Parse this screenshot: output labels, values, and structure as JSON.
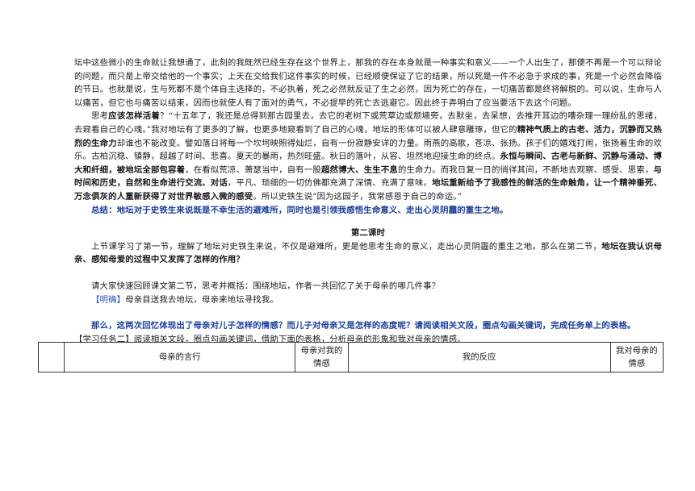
{
  "para1": "坛中这些微小的生命就让我想通了，此刻的我既然已经生存在这个世界上，那我的存在本身就是一种事实和意义——一个人出生了，那便不再是一个可以辩论的问题，而只是上帝交给他的一个事实；上天在交给我们这件事实的时候，已经顺便保证了它的结果，所以死是一件不必急于求成的事，死是一个必然会降临的节日。也就是说，生与死都不是个体自主选择的，不必执着，死之必然就反证了生之必然，因为死亡的存在，一切痛苦都是终将解脱的。可以说，生命与人以痛苦，但它也与痛苦以结束，因而也就使人有了面对的勇气，不必提早的死亡去逃避它。因此终于弄明白了应当要活下去这个问题。",
  "para2": {
    "s1": "思考",
    "s2": "应该怎样活着",
    "s3": "？“十五年了，我还是总得到那古园里去，去它的老树下或荒草边或颓墙旁，去默坐，去呆想，去推开耳边的嘈杂理一理纷乱的思绪，去窥看自己的心魂。”我对地坛有了更多的了解，也更多地窥看到了自己的心魂，地坛的形体可以被人肆意雕琢，但它的",
    "s4": "精神气质上的古老、活力，沉静而又热烈的生命力",
    "s5": "却谁也不能改变。譬如落日将每一个坎坷映照得灿烂，自有一份寂静安详的力量。雨燕的高歌，苍凉、张扬。孩子们的嬉戏打闹，张扬着生命的欢乐。古柏沉稳、镇静，超越了时间、悲喜。夏天的暴雨，热烈旺盛。秋日的落叶，从容、坦然地迎接生命的终点。",
    "s6": "永恒与瞬间、古老与新鲜、沉静与涌动、博大和纤细，被地坛全部包容着",
    "s7": "，在看似荒凉、萧瑟当中，自有一股",
    "s8": "超然博大、生生不息",
    "s9": "的生命力。而我日复一日的徜徉其间，不断地去观察、感受、思索，",
    "s10": "与时间和历史，自然和生命进行交流、对话",
    "s11": "，平凡、琐细的一切仿佛都充满了深情、充满了意味。",
    "s12": "地坛重新给予了我感性的鲜活的生命触角，让一个精神垂死、万念俱灰的人重新获得了对世界敏感入微的感受",
    "s13": "。所以史铁生说“因为这园子，我常感恩于自己的命运。”"
  },
  "summary": "总结：地坛对于史铁生来说既是不幸生活的避难所，同时也是引领我感悟生命意义、走出心灵阴霾的重生之地。",
  "heading": "第二课时",
  "para3": {
    "s1": "上节课学习了第一节，理解了地坛对史铁生来说，不仅是避难所，更是他思考生命的意义，走出心灵阴霾的重生之地。那么在第二节，",
    "s2": "地坛在我认识母亲、感知母爱的过程中又发挥了怎样的作用？"
  },
  "question": "请大家快速回顾课文第二节，思考并概括：围绕地坛，作者一共回忆了关于母亲的哪几件事？",
  "answer": {
    "tag": "【明确】",
    "text": "母亲目送我去地坛，母亲来地坛寻找我。"
  },
  "prompt": "那么，这两次回忆体现出了母亲对儿子怎样的情感？而儿子对母亲又是怎样的态度呢？请阅读相关文段，圈点勾画关键词，完成任务单上的表格。",
  "task": {
    "tag": "【学习任务二】",
    "text": "阅读相关文段，圈点勾画关键词，借助下面的表格，分析母亲的形象和我对母亲的情感。"
  },
  "table": {
    "headers": [
      "",
      "母亲的言行",
      "母亲对我的情感",
      "我的反应",
      "我对母亲的情感"
    ]
  }
}
